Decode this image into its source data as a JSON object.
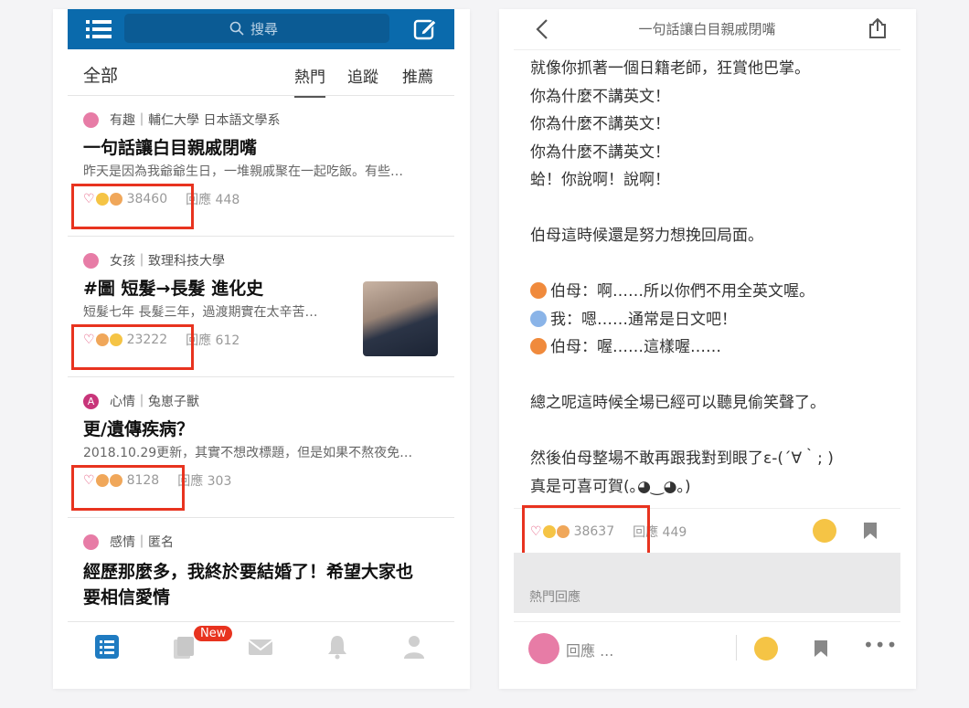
{
  "left": {
    "search_placeholder": "搜尋",
    "tabs": {
      "all": "全部",
      "hot": "熱門",
      "follow": "追蹤",
      "recommend": "推薦"
    },
    "posts": [
      {
        "board": "有趣｜輔仁大學 日本語文學系",
        "title": "一句話讓白目親戚閉嘴",
        "excerpt": "昨天是因為我爺爺生日，一堆親戚聚在一起吃飯。有些…",
        "likes": "38460",
        "replies": "回應 448"
      },
      {
        "board": "女孩｜致理科技大學",
        "title": "#圖  短髮→長髮 進化史",
        "excerpt": "短髮七年 長髮三年，過渡期實在太辛苦…",
        "likes": "23222",
        "replies": "回應 612"
      },
      {
        "board": "心情｜兔崽子獸",
        "avatar_letter": "A",
        "title": "更/遺傳疾病？",
        "excerpt": "2018.10.29更新，其實不想改標題，但是如果不熬夜免…",
        "likes": "8128",
        "replies": "回應 303"
      },
      {
        "board": "感情｜匿名",
        "title_line1": "經歷那麼多，我終於要結婚了！希望大家也",
        "title_line2": "要相信愛情"
      }
    ],
    "badge_new": "New"
  },
  "right": {
    "header_title": "一句話讓白目親戚閉嘴",
    "lines": [
      "就像你抓著一個日籍老師，狂賞他巴掌。",
      "你為什麼不講英文！",
      "你為什麼不講英文！",
      "你為什麼不講英文！",
      "蛤！你說啊！說啊！",
      "",
      "伯母這時候還是努力想挽回局面。",
      "",
      "伯母：啊……所以你們不用全英文喔。",
      "我：嗯……通常是日文吧！",
      "伯母：喔……這樣喔……",
      "",
      "總之呢這時候全場已經可以聽見偷笑聲了。",
      "",
      "然後伯母整場不敢再跟我對到眼了ε-(´∀｀; )",
      "真是可喜可賀(｡◕‿◕｡)"
    ],
    "likes": "38637",
    "replies": "回應 449",
    "hot_replies": "熱門回應",
    "reply_placeholder": "回應 ..."
  },
  "colors": {
    "brand": "#0a6aac",
    "highlight": "#e8331f",
    "heart": "#e0406a"
  }
}
